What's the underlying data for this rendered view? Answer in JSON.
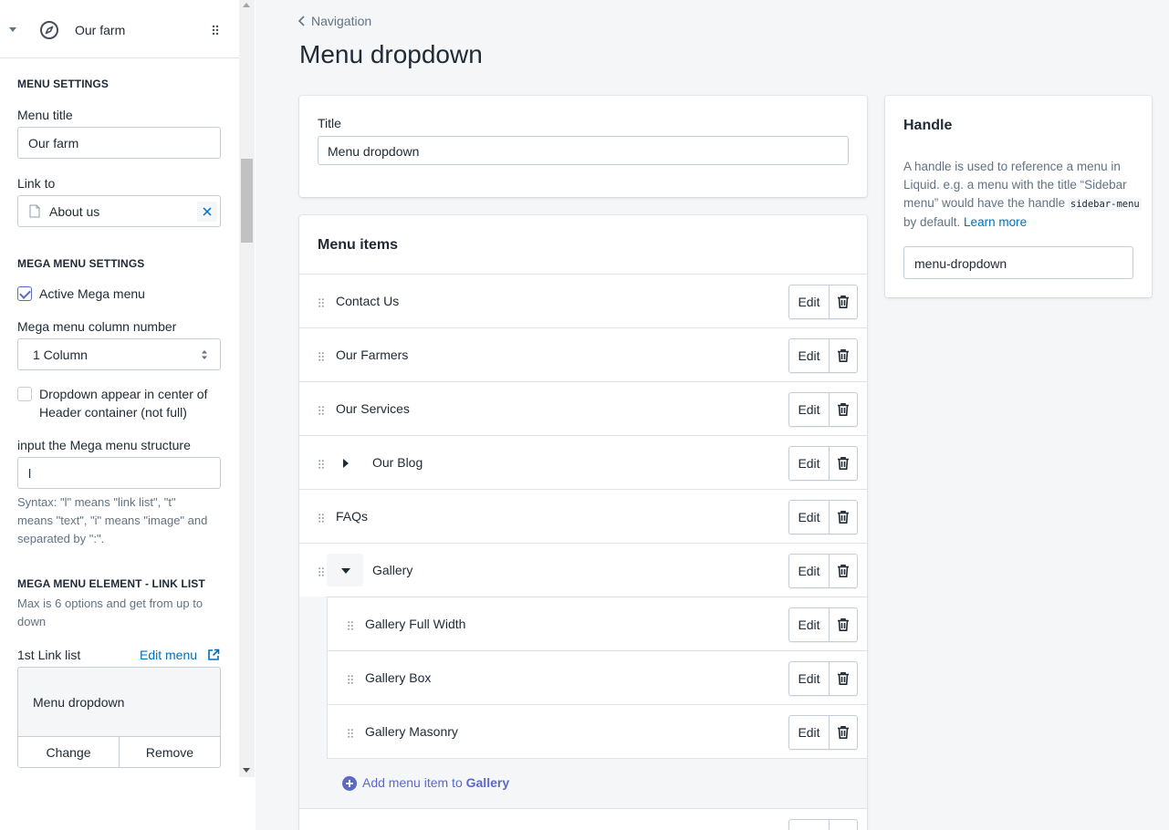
{
  "sidebar": {
    "header_title": "Our farm",
    "menu_settings": {
      "section_title": "MENU SETTINGS",
      "menu_title_label": "Menu title",
      "menu_title_value": "Our farm",
      "link_to_label": "Link to",
      "link_to_value": "About us"
    },
    "mega_menu_settings": {
      "section_title": "MEGA MENU SETTINGS",
      "active_label": "Active Mega menu",
      "active_checked": true,
      "column_label": "Mega menu column number",
      "column_value": "1 Column",
      "center_label": "Dropdown appear in center of Header container (not full)",
      "center_checked": false,
      "structure_label": "input the Mega menu structure",
      "structure_value": "l",
      "syntax_hint": "Syntax: \"l\" means \"link list\", \"t\" means \"text\", \"i\" means \"image\" and separated by \":\"."
    },
    "link_list_element": {
      "section_title": "MEGA MENU ELEMENT - LINK LIST",
      "hint": "Max is 6 options and get from up to down",
      "first_label": "1st Link list",
      "edit_menu": "Edit menu",
      "selected": "Menu dropdown",
      "change": "Change",
      "remove": "Remove"
    }
  },
  "main": {
    "breadcrumb": "Navigation",
    "page_title": "Menu dropdown",
    "title_card": {
      "label": "Title",
      "value": "Menu dropdown"
    },
    "menu_items": {
      "title": "Menu items",
      "edit_label": "Edit",
      "items": [
        {
          "name": "Contact Us"
        },
        {
          "name": "Our Farmers"
        },
        {
          "name": "Our Services"
        },
        {
          "name": "Our Blog",
          "toggle": "collapsed"
        },
        {
          "name": "FAQs"
        },
        {
          "name": "Gallery",
          "toggle": "expanded"
        }
      ],
      "gallery_children": [
        {
          "name": "Gallery Full Width"
        },
        {
          "name": "Gallery Box"
        },
        {
          "name": "Gallery Masonry"
        }
      ],
      "add_item_prefix": "Add menu item to ",
      "add_item_target": "Gallery"
    },
    "handle_card": {
      "title": "Handle",
      "desc_1": "A handle is used to reference a menu in Liquid. e.g. a menu with the title “Sidebar menu” would have the handle ",
      "code": "sidebar-menu",
      "desc_2": " by default. ",
      "learn_more": "Learn more",
      "value": "menu-dropdown"
    }
  },
  "colors": {
    "accent": "#5c6ac4",
    "link": "#006fbb",
    "text": "#212b36",
    "subdued": "#637381",
    "background": "#f4f6f8",
    "border": "#c4cdd5"
  }
}
